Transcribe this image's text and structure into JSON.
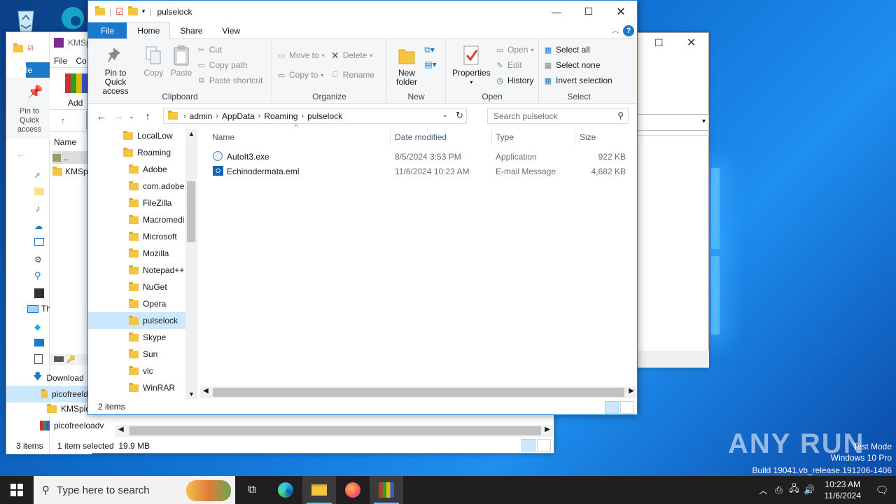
{
  "explorer": {
    "title": "pulselock",
    "tabs": [
      "File",
      "Home",
      "Share",
      "View"
    ],
    "ribbon": {
      "clipboard": {
        "label": "Clipboard",
        "pin": "Pin to Quick access",
        "copy": "Copy",
        "paste": "Paste",
        "cut": "Cut",
        "copy_path": "Copy path",
        "paste_shortcut": "Paste shortcut"
      },
      "organize": {
        "label": "Organize",
        "move_to": "Move to",
        "copy_to": "Copy to",
        "delete": "Delete",
        "rename": "Rename"
      },
      "new": {
        "label": "New",
        "new_folder": "New folder"
      },
      "open": {
        "label": "Open",
        "properties": "Properties",
        "open": "Open",
        "edit": "Edit",
        "history": "History"
      },
      "select": {
        "label": "Select",
        "select_all": "Select all",
        "select_none": "Select none",
        "invert": "Invert selection"
      }
    },
    "breadcrumb": [
      "admin",
      "AppData",
      "Roaming",
      "pulselock"
    ],
    "search_placeholder": "Search pulselock",
    "nav": [
      "LocalLow",
      "Roaming",
      "Adobe",
      "com.adobe.",
      "FileZilla",
      "Macromedi",
      "Microsoft",
      "Mozilla",
      "Notepad++",
      "NuGet",
      "Opera",
      "pulselock",
      "Skype",
      "Sun",
      "vlc",
      "WinRAR"
    ],
    "columns": [
      "Name",
      "Date modified",
      "Type",
      "Size"
    ],
    "files": [
      {
        "name": "AutoIt3.exe",
        "date": "8/5/2024 3:53 PM",
        "type": "Application",
        "size": "922 KB"
      },
      {
        "name": "Echinodermata.eml",
        "date": "11/6/2024 10:23 AM",
        "type": "E-mail Message",
        "size": "4,682 KB"
      }
    ],
    "status": "2 items"
  },
  "back_window": {
    "title": "KMSp",
    "menu": [
      "File",
      "Co"
    ],
    "add_label": "Add",
    "col_name": "Name",
    "rows": [
      "..",
      "KMSp"
    ]
  },
  "left_explorer": {
    "file_tab": "File",
    "pin": "Pin to Quick access",
    "tree": [
      "Th",
      "Download",
      "picofreeld",
      "KMSpic",
      "picofreeloadv"
    ],
    "status_items": "3 items",
    "status_selected": "1 item selected  19.9 MB"
  },
  "taskbar": {
    "search_placeholder": "Type here to search",
    "time": "10:23 AM",
    "date": "11/6/2024"
  },
  "watermark": {
    "brand": "ANY RUN",
    "line1": "Test Mode",
    "line2": "Windows 10 Pro",
    "line3": "Build 19041.vb_release.191206-1406"
  }
}
